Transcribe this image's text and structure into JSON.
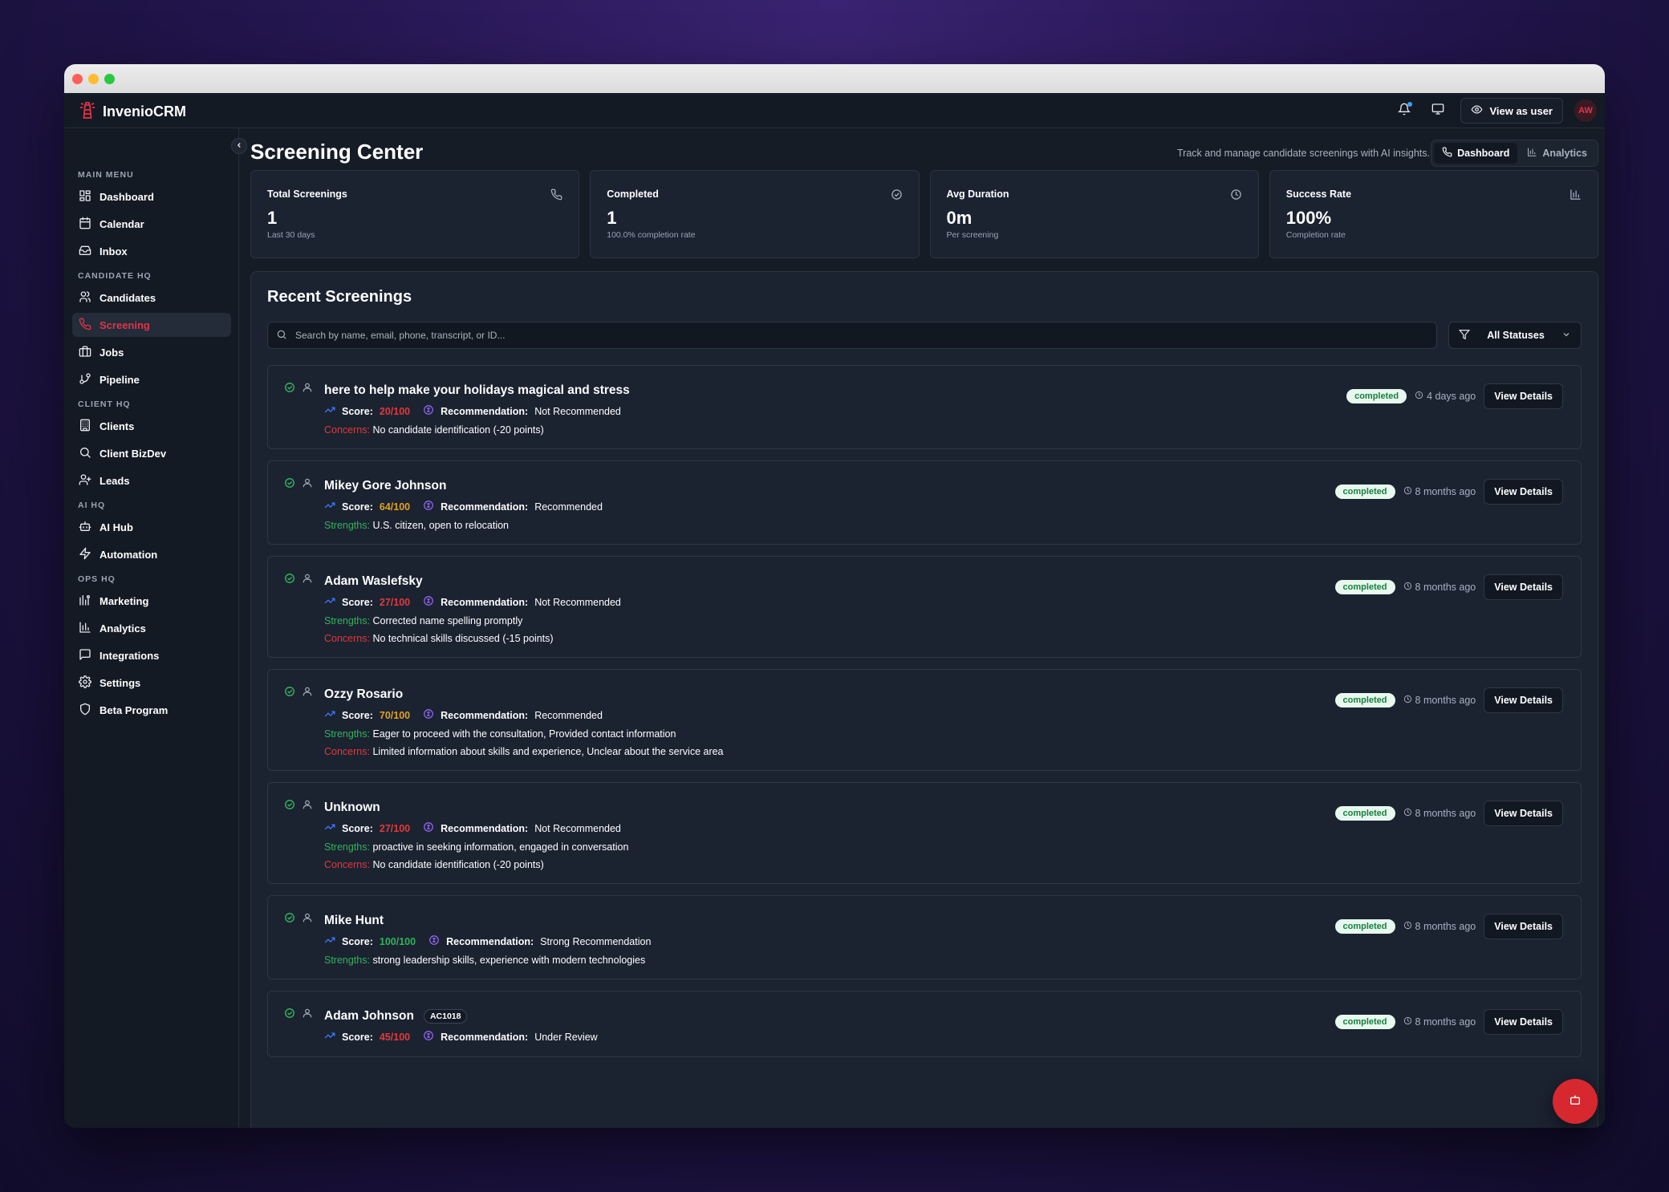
{
  "app": {
    "name": "InvenioCRM"
  },
  "topbar": {
    "view_as_label": "View as user",
    "avatar_initials": "AW"
  },
  "sidebar": {
    "sections": [
      {
        "title": "MAIN MENU",
        "items": [
          {
            "label": "Dashboard",
            "icon": "dashboard-icon"
          },
          {
            "label": "Calendar",
            "icon": "calendar-icon"
          },
          {
            "label": "Inbox",
            "icon": "inbox-icon"
          }
        ]
      },
      {
        "title": "CANDIDATE HQ",
        "items": [
          {
            "label": "Candidates",
            "icon": "users-icon"
          },
          {
            "label": "Screening",
            "icon": "phone-icon",
            "active": true
          },
          {
            "label": "Jobs",
            "icon": "briefcase-icon"
          },
          {
            "label": "Pipeline",
            "icon": "pipeline-icon"
          }
        ]
      },
      {
        "title": "CLIENT HQ",
        "items": [
          {
            "label": "Clients",
            "icon": "building-icon"
          },
          {
            "label": "Client BizDev",
            "icon": "search-icon"
          },
          {
            "label": "Leads",
            "icon": "user-plus-icon"
          }
        ]
      },
      {
        "title": "AI HQ",
        "items": [
          {
            "label": "AI Hub",
            "icon": "bot-icon"
          },
          {
            "label": "Automation",
            "icon": "zap-icon"
          }
        ]
      },
      {
        "title": "OPS HQ",
        "items": [
          {
            "label": "Marketing",
            "icon": "marketing-icon"
          },
          {
            "label": "Analytics",
            "icon": "bar-chart-icon"
          },
          {
            "label": "Integrations",
            "icon": "message-icon"
          },
          {
            "label": "Settings",
            "icon": "gear-icon"
          },
          {
            "label": "Beta Program",
            "icon": "shield-icon"
          }
        ]
      }
    ]
  },
  "header": {
    "title": "Screening Center",
    "subtitle": "Track and manage candidate screenings with AI insights.",
    "tabs": [
      {
        "label": "Dashboard",
        "active": true
      },
      {
        "label": "Analytics",
        "active": false
      }
    ]
  },
  "stats": [
    {
      "label": "Total Screenings",
      "value": "1",
      "note": "Last 30 days",
      "icon": "phone-icon"
    },
    {
      "label": "Completed",
      "value": "1",
      "note": "100.0% completion rate",
      "icon": "check-circle-icon"
    },
    {
      "label": "Avg Duration",
      "value": "0m",
      "note": "Per screening",
      "icon": "clock-icon"
    },
    {
      "label": "Success Rate",
      "value": "100%",
      "note": "Completion rate",
      "icon": "bar-chart-icon"
    }
  ],
  "recent": {
    "title": "Recent Screenings",
    "search_placeholder": "Search by name, email, phone, transcript, or ID...",
    "filter_label": "All Statuses",
    "score_label": "Score:",
    "recommendation_label": "Recommendation:",
    "strengths_label": "Strengths:",
    "concerns_label": "Concerns:",
    "details_label": "View Details",
    "items": [
      {
        "name": "here to help make your holidays magical and stress",
        "score": "20/100",
        "score_color": "#e03a3a",
        "recommendation": "Not Recommended",
        "strengths": "",
        "concerns": "No candidate identification (-20 points)",
        "status": "completed",
        "ago": "4 days ago",
        "tag": ""
      },
      {
        "name": "Mikey Gore Johnson",
        "score": "64/100",
        "score_color": "#e0a21f",
        "recommendation": "Recommended",
        "strengths": "U.S. citizen, open to relocation",
        "concerns": "",
        "status": "completed",
        "ago": "8 months ago",
        "tag": ""
      },
      {
        "name": "Adam Waslefsky",
        "score": "27/100",
        "score_color": "#e03a3a",
        "recommendation": "Not Recommended",
        "strengths": "Corrected name spelling promptly",
        "concerns": "No technical skills discussed (-15 points)",
        "status": "completed",
        "ago": "8 months ago",
        "tag": ""
      },
      {
        "name": "Ozzy Rosario",
        "score": "70/100",
        "score_color": "#e0a21f",
        "recommendation": "Recommended",
        "strengths": "Eager to proceed with the consultation, Provided contact information",
        "concerns": "Limited information about skills and experience, Unclear about the service area",
        "status": "completed",
        "ago": "8 months ago",
        "tag": ""
      },
      {
        "name": "Unknown",
        "score": "27/100",
        "score_color": "#e03a3a",
        "recommendation": "Not Recommended",
        "strengths": "proactive in seeking information, engaged in conversation",
        "concerns": "No candidate identification (-20 points)",
        "status": "completed",
        "ago": "8 months ago",
        "tag": ""
      },
      {
        "name": "Mike Hunt",
        "score": "100/100",
        "score_color": "#2fb45a",
        "recommendation": "Strong Recommendation",
        "strengths": "strong leadership skills, experience with modern technologies",
        "concerns": "",
        "status": "completed",
        "ago": "8 months ago",
        "tag": ""
      },
      {
        "name": "Adam Johnson",
        "score": "45/100",
        "score_color": "#e03a3a",
        "recommendation": "Under Review",
        "strengths": "",
        "concerns": "",
        "status": "completed",
        "ago": "8 months ago",
        "tag": "AC1018"
      }
    ]
  },
  "colors": {
    "accent": "#e0344a",
    "success": "#2fb45a",
    "danger": "#e03a3a",
    "warning": "#e0a21f",
    "link_blue": "#3a7dff",
    "ai_purple": "#9b6bff"
  }
}
